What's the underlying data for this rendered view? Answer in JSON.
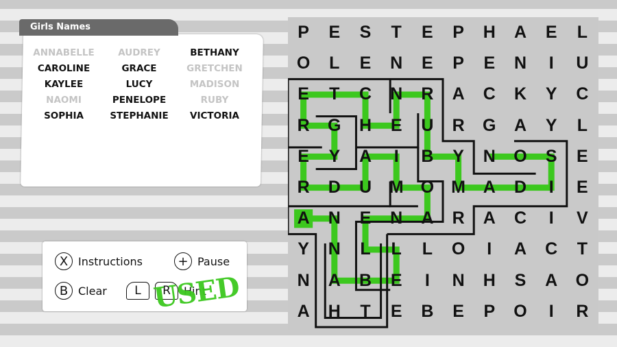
{
  "word_list": {
    "title": "Girls Names",
    "names": [
      {
        "label": "ANNABELLE",
        "found": true
      },
      {
        "label": "AUDREY",
        "found": true
      },
      {
        "label": "BETHANY",
        "found": false
      },
      {
        "label": "CAROLINE",
        "found": false
      },
      {
        "label": "GRACE",
        "found": false
      },
      {
        "label": "GRETCHEN",
        "found": true
      },
      {
        "label": "KAYLEE",
        "found": false
      },
      {
        "label": "LUCY",
        "found": false
      },
      {
        "label": "MADISON",
        "found": true
      },
      {
        "label": "NAOMI",
        "found": true
      },
      {
        "label": "PENELOPE",
        "found": false
      },
      {
        "label": "RUBY",
        "found": true
      },
      {
        "label": "SOPHIA",
        "found": false
      },
      {
        "label": "STEPHANIE",
        "found": false
      },
      {
        "label": "VICTORIA",
        "found": false
      }
    ]
  },
  "controls": {
    "instructions": {
      "button": "X",
      "label": "Instructions"
    },
    "pause": {
      "button": "+",
      "label": "Pause"
    },
    "clear": {
      "button": "B",
      "label": "Clear"
    },
    "hint": {
      "button_left": "L",
      "button_right": "R",
      "label": "Hint"
    }
  },
  "stamp": "USED",
  "colors": {
    "path": "#3cc81e",
    "maze": "#111111",
    "board": "#c9c9c9"
  },
  "grid": [
    "PESTEPHAEL",
    "OLENEPENIU",
    "ETCNRACKYC",
    "RGHEURGAYL",
    "EYAIBYNOSE",
    "RDUMOMADIE",
    "ANENARACIV",
    "YNLLLOIACT",
    "NABEINHSAO",
    "AHTEBEPOIR"
  ]
}
